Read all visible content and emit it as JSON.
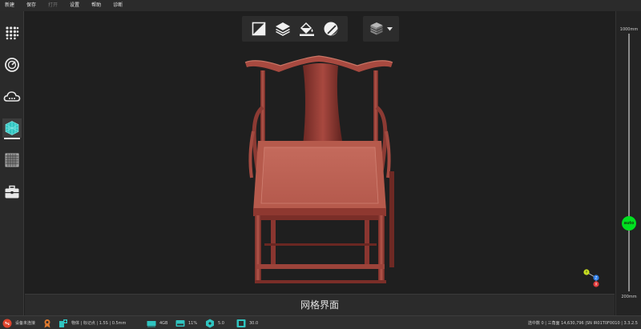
{
  "menu": {
    "items": [
      {
        "label": "新建",
        "enabled": true
      },
      {
        "label": "保存",
        "enabled": true
      },
      {
        "label": "打开",
        "enabled": false
      },
      {
        "label": "设置",
        "enabled": true
      },
      {
        "label": "帮助",
        "enabled": true
      },
      {
        "label": "诊断",
        "enabled": true
      }
    ]
  },
  "sidebar": {
    "items": [
      {
        "icon": "dot-grid-icon"
      },
      {
        "icon": "turntable-icon"
      },
      {
        "icon": "cloud-icon"
      },
      {
        "icon": "mesh-cube-icon",
        "active": true
      },
      {
        "icon": "grid-texture-icon"
      },
      {
        "icon": "toolbox-icon"
      }
    ]
  },
  "toolbar": {
    "tools": [
      "flat-shading-icon",
      "layers-icon",
      "paint-fill-icon",
      "sphere-shading-icon"
    ],
    "dropdown_icon": "stacked-cube-icon"
  },
  "slider": {
    "max_label": "1000mm",
    "min_label": "200mm",
    "value_label": "auto",
    "accent": "#00e020"
  },
  "gizmo": {
    "y_label": "Y",
    "z_label": "Z",
    "x_label": "X"
  },
  "caption": "网格界面",
  "status": {
    "connection": "设备未连接",
    "mode": "物体 | 标记点 | 1.5S | 0.5mm",
    "memory": "4GB",
    "disk": "11%",
    "fps": "5.0",
    "temp": "30.0",
    "selection": "选中数 0 | 三角面 14,630,796 |SN IR01T0F0010 | 3.3.2.5"
  },
  "colors": {
    "chair": "#a84a40",
    "background": "#1f1f1f"
  }
}
